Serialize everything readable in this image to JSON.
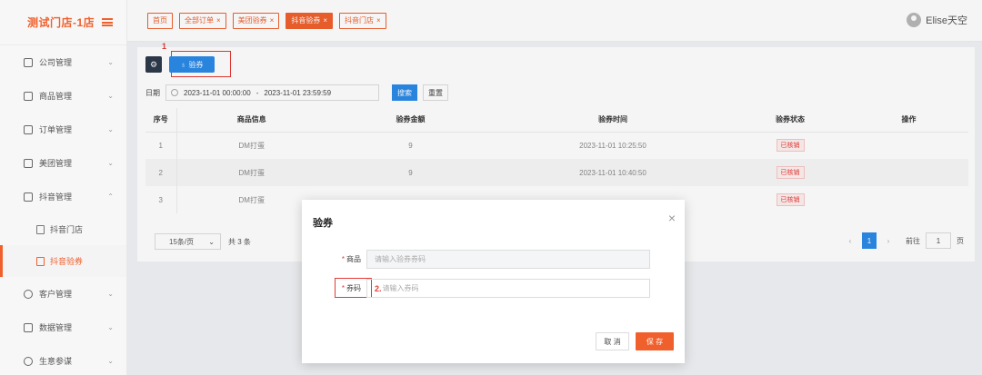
{
  "sidebar": {
    "store_name": "测试门店-1店",
    "menu": [
      {
        "label": "公司管理",
        "arrow": "⌄"
      },
      {
        "label": "商品管理",
        "arrow": "⌄"
      },
      {
        "label": "订单管理",
        "arrow": "⌄"
      },
      {
        "label": "美团管理",
        "arrow": "⌄"
      },
      {
        "label": "抖音管理",
        "arrow": "⌃"
      }
    ],
    "douyin_sub": [
      {
        "label": "抖音门店"
      },
      {
        "label": "抖音验券"
      }
    ],
    "menu_bottom": [
      {
        "label": "客户管理",
        "arrow": "⌄"
      },
      {
        "label": "数据管理",
        "arrow": "⌄"
      },
      {
        "label": "生意参谋",
        "arrow": "⌄"
      }
    ]
  },
  "tabs": [
    {
      "label": "首页",
      "closable": false
    },
    {
      "label": "全部订单",
      "closable": true
    },
    {
      "label": "美团验券",
      "closable": true
    },
    {
      "label": "抖音验券",
      "closable": true
    },
    {
      "label": "抖音门店",
      "closable": true
    }
  ],
  "tab_close_glyph": "×",
  "user": {
    "name": "Elise天空"
  },
  "toolbar": {
    "gear_glyph": "⚙",
    "redeem_icon": "♁",
    "redeem_label": "验券",
    "step_marker": "1"
  },
  "filter": {
    "label": "日期",
    "start": "2023-11-01 00:00:00",
    "separator": "-",
    "end": "2023-11-01 23:59:59",
    "search_label": "搜索",
    "reset_label": "重置"
  },
  "table": {
    "headers": [
      "序号",
      "商品信息",
      "验券金额",
      "验券时间",
      "验券状态",
      "操作"
    ],
    "rows": [
      {
        "index": "1",
        "product": "DM打蛋",
        "amount": "9",
        "time": "2023-11-01 10:25:50",
        "status": "已核销"
      },
      {
        "index": "2",
        "product": "DM打蛋",
        "amount": "9",
        "time": "2023-11-01 10:40:50",
        "status": "已核销"
      },
      {
        "index": "3",
        "product": "DM打蛋",
        "amount": "",
        "time": "",
        "status": "已核销"
      }
    ]
  },
  "pagination": {
    "page_size": "15条/页",
    "total": "共 3 条",
    "current_page": "1",
    "goto_label": "前往",
    "goto_value": "1",
    "page_unit": "页",
    "prev_glyph": "‹",
    "next_glyph": "›",
    "select_arrow": "⌄"
  },
  "dialog": {
    "title": "验券",
    "close_glyph": "×",
    "fields": [
      {
        "required_mark": "*",
        "label": "商品",
        "placeholder": "请输入验券券码"
      },
      {
        "required_mark": "*",
        "label": "券码",
        "placeholder": "请输入券码",
        "step_marker": "2."
      }
    ],
    "cancel_label": "取 消",
    "save_label": "保 存"
  },
  "colors": {
    "brand": "#f0602d",
    "primary": "#2b8ae8",
    "annotation": "#e53935"
  }
}
